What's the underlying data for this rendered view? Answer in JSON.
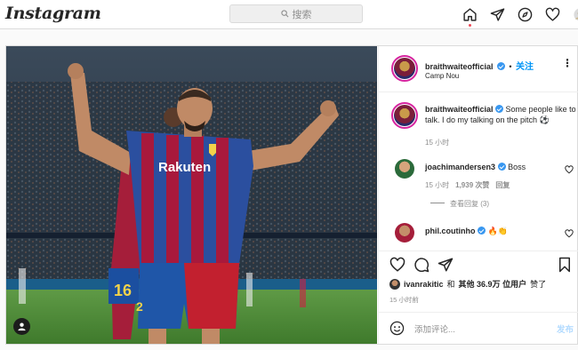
{
  "nav": {
    "logo": "Instagram",
    "search_placeholder": "搜索",
    "icons": [
      "home-icon",
      "direct-icon",
      "explore-icon",
      "activity-heart-icon",
      "profile-avatar"
    ]
  },
  "post": {
    "author": "braithwaiteofficial",
    "follow_label": "关注",
    "location": "Camp Nou",
    "caption": "Some people like to talk. I do my talking on the pitch ⚽",
    "caption_time": "15 小时",
    "comments": [
      {
        "user": "joachimandersen3",
        "text": "Boss",
        "time": "15 小时",
        "likes": "1,939 次赞",
        "reply": "回复",
        "view_replies": "查看回复 (3)"
      },
      {
        "user": "phil.coutinho",
        "text": "🔥👏"
      }
    ],
    "liked_by_user": "ivanrakitic",
    "liked_by_and": "和",
    "liked_by_rest": "其他 36.9万 位用户",
    "liked_suffix": "赞了",
    "time_ago": "15 小时前",
    "comment_placeholder": "添加评论...",
    "post_button": "发布"
  },
  "colors": {
    "accent": "#0095f6",
    "verified": "#3897f0",
    "notification": "#ed4956"
  }
}
